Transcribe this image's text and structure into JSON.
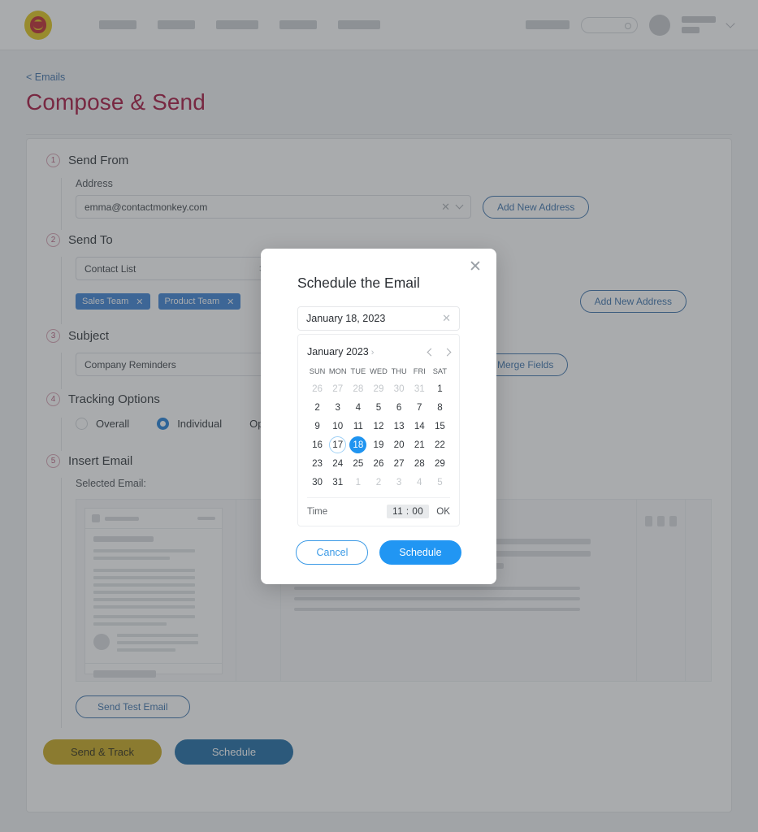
{
  "topbar": {
    "logo_name": "contactmonkey-logo",
    "nav_placeholder_widths": [
      46,
      46,
      52,
      46,
      52
    ],
    "search_placeholder": "",
    "user_menu_icon": "chevron-down-icon"
  },
  "header": {
    "breadcrumb": "< Emails",
    "title": "Compose & Send"
  },
  "steps": {
    "send_from": {
      "number": "1",
      "label": "Send From",
      "address_label": "Address",
      "address_value": "emma@contactmonkey.com",
      "add_address_button": "Add New Address"
    },
    "send_to": {
      "number": "2",
      "label": "Send To",
      "list_type_value": "Contact List",
      "tags": [
        "Sales Team",
        "Product Team"
      ],
      "add_address_button": "Add New Address"
    },
    "subject": {
      "number": "3",
      "label": "Subject",
      "value": "Company Reminders",
      "merge_fields_button": "Merge Fields"
    },
    "tracking": {
      "number": "4",
      "label": "Tracking Options",
      "options": [
        "Overall",
        "Individual",
        "Open"
      ],
      "selected": "Individual"
    },
    "insert_email": {
      "number": "5",
      "label": "Insert Email",
      "selected_email_label": "Selected Email:",
      "send_test_button": "Send Test Email"
    }
  },
  "footer": {
    "send_track_button": "Send & Track",
    "schedule_button": "Schedule"
  },
  "modal": {
    "title": "Schedule the Email",
    "close_icon": "close-icon",
    "date_value": "January 18, 2023",
    "date_clear_icon": "close-icon",
    "month_label": "January 2023",
    "month_caret": "›",
    "prev_icon": "chevron-left-icon",
    "next_icon": "chevron-right-icon",
    "weekdays": [
      "SUN",
      "MON",
      "TUE",
      "WED",
      "THU",
      "FRI",
      "SAT"
    ],
    "weeks": [
      [
        {
          "d": "26",
          "m": true
        },
        {
          "d": "27",
          "m": true
        },
        {
          "d": "28",
          "m": true
        },
        {
          "d": "29",
          "m": true
        },
        {
          "d": "30",
          "m": true
        },
        {
          "d": "31",
          "m": true
        },
        {
          "d": "1",
          "m": false
        }
      ],
      [
        {
          "d": "2",
          "m": false
        },
        {
          "d": "3",
          "m": false
        },
        {
          "d": "4",
          "m": false
        },
        {
          "d": "5",
          "m": false
        },
        {
          "d": "6",
          "m": false
        },
        {
          "d": "7",
          "m": false
        },
        {
          "d": "8",
          "m": false
        }
      ],
      [
        {
          "d": "9",
          "m": false
        },
        {
          "d": "10",
          "m": false
        },
        {
          "d": "11",
          "m": false
        },
        {
          "d": "12",
          "m": false
        },
        {
          "d": "13",
          "m": false
        },
        {
          "d": "14",
          "m": false
        },
        {
          "d": "15",
          "m": false
        }
      ],
      [
        {
          "d": "16",
          "m": false
        },
        {
          "d": "17",
          "m": false,
          "today": true
        },
        {
          "d": "18",
          "m": false,
          "sel": true
        },
        {
          "d": "19",
          "m": false
        },
        {
          "d": "20",
          "m": false
        },
        {
          "d": "21",
          "m": false
        },
        {
          "d": "22",
          "m": false
        }
      ],
      [
        {
          "d": "23",
          "m": false
        },
        {
          "d": "24",
          "m": false
        },
        {
          "d": "25",
          "m": false
        },
        {
          "d": "26",
          "m": false
        },
        {
          "d": "27",
          "m": false
        },
        {
          "d": "28",
          "m": false
        },
        {
          "d": "29",
          "m": false
        }
      ],
      [
        {
          "d": "30",
          "m": false
        },
        {
          "d": "31",
          "m": false
        },
        {
          "d": "1",
          "m": true
        },
        {
          "d": "2",
          "m": true
        },
        {
          "d": "3",
          "m": true
        },
        {
          "d": "4",
          "m": true
        },
        {
          "d": "5",
          "m": true
        }
      ]
    ],
    "time_label": "Time",
    "time_value": "11 : 00",
    "time_ok": "OK",
    "cancel_button": "Cancel",
    "schedule_button": "Schedule"
  },
  "colors": {
    "brand_red": "#a6123c",
    "logo_gold": "#e0c518",
    "accent_blue": "#2196f3",
    "selected_day": "#1f94f0",
    "tag_blue": "#3b82d6",
    "gold_button": "#c9a81d",
    "blue_button": "#1c6ba5"
  }
}
